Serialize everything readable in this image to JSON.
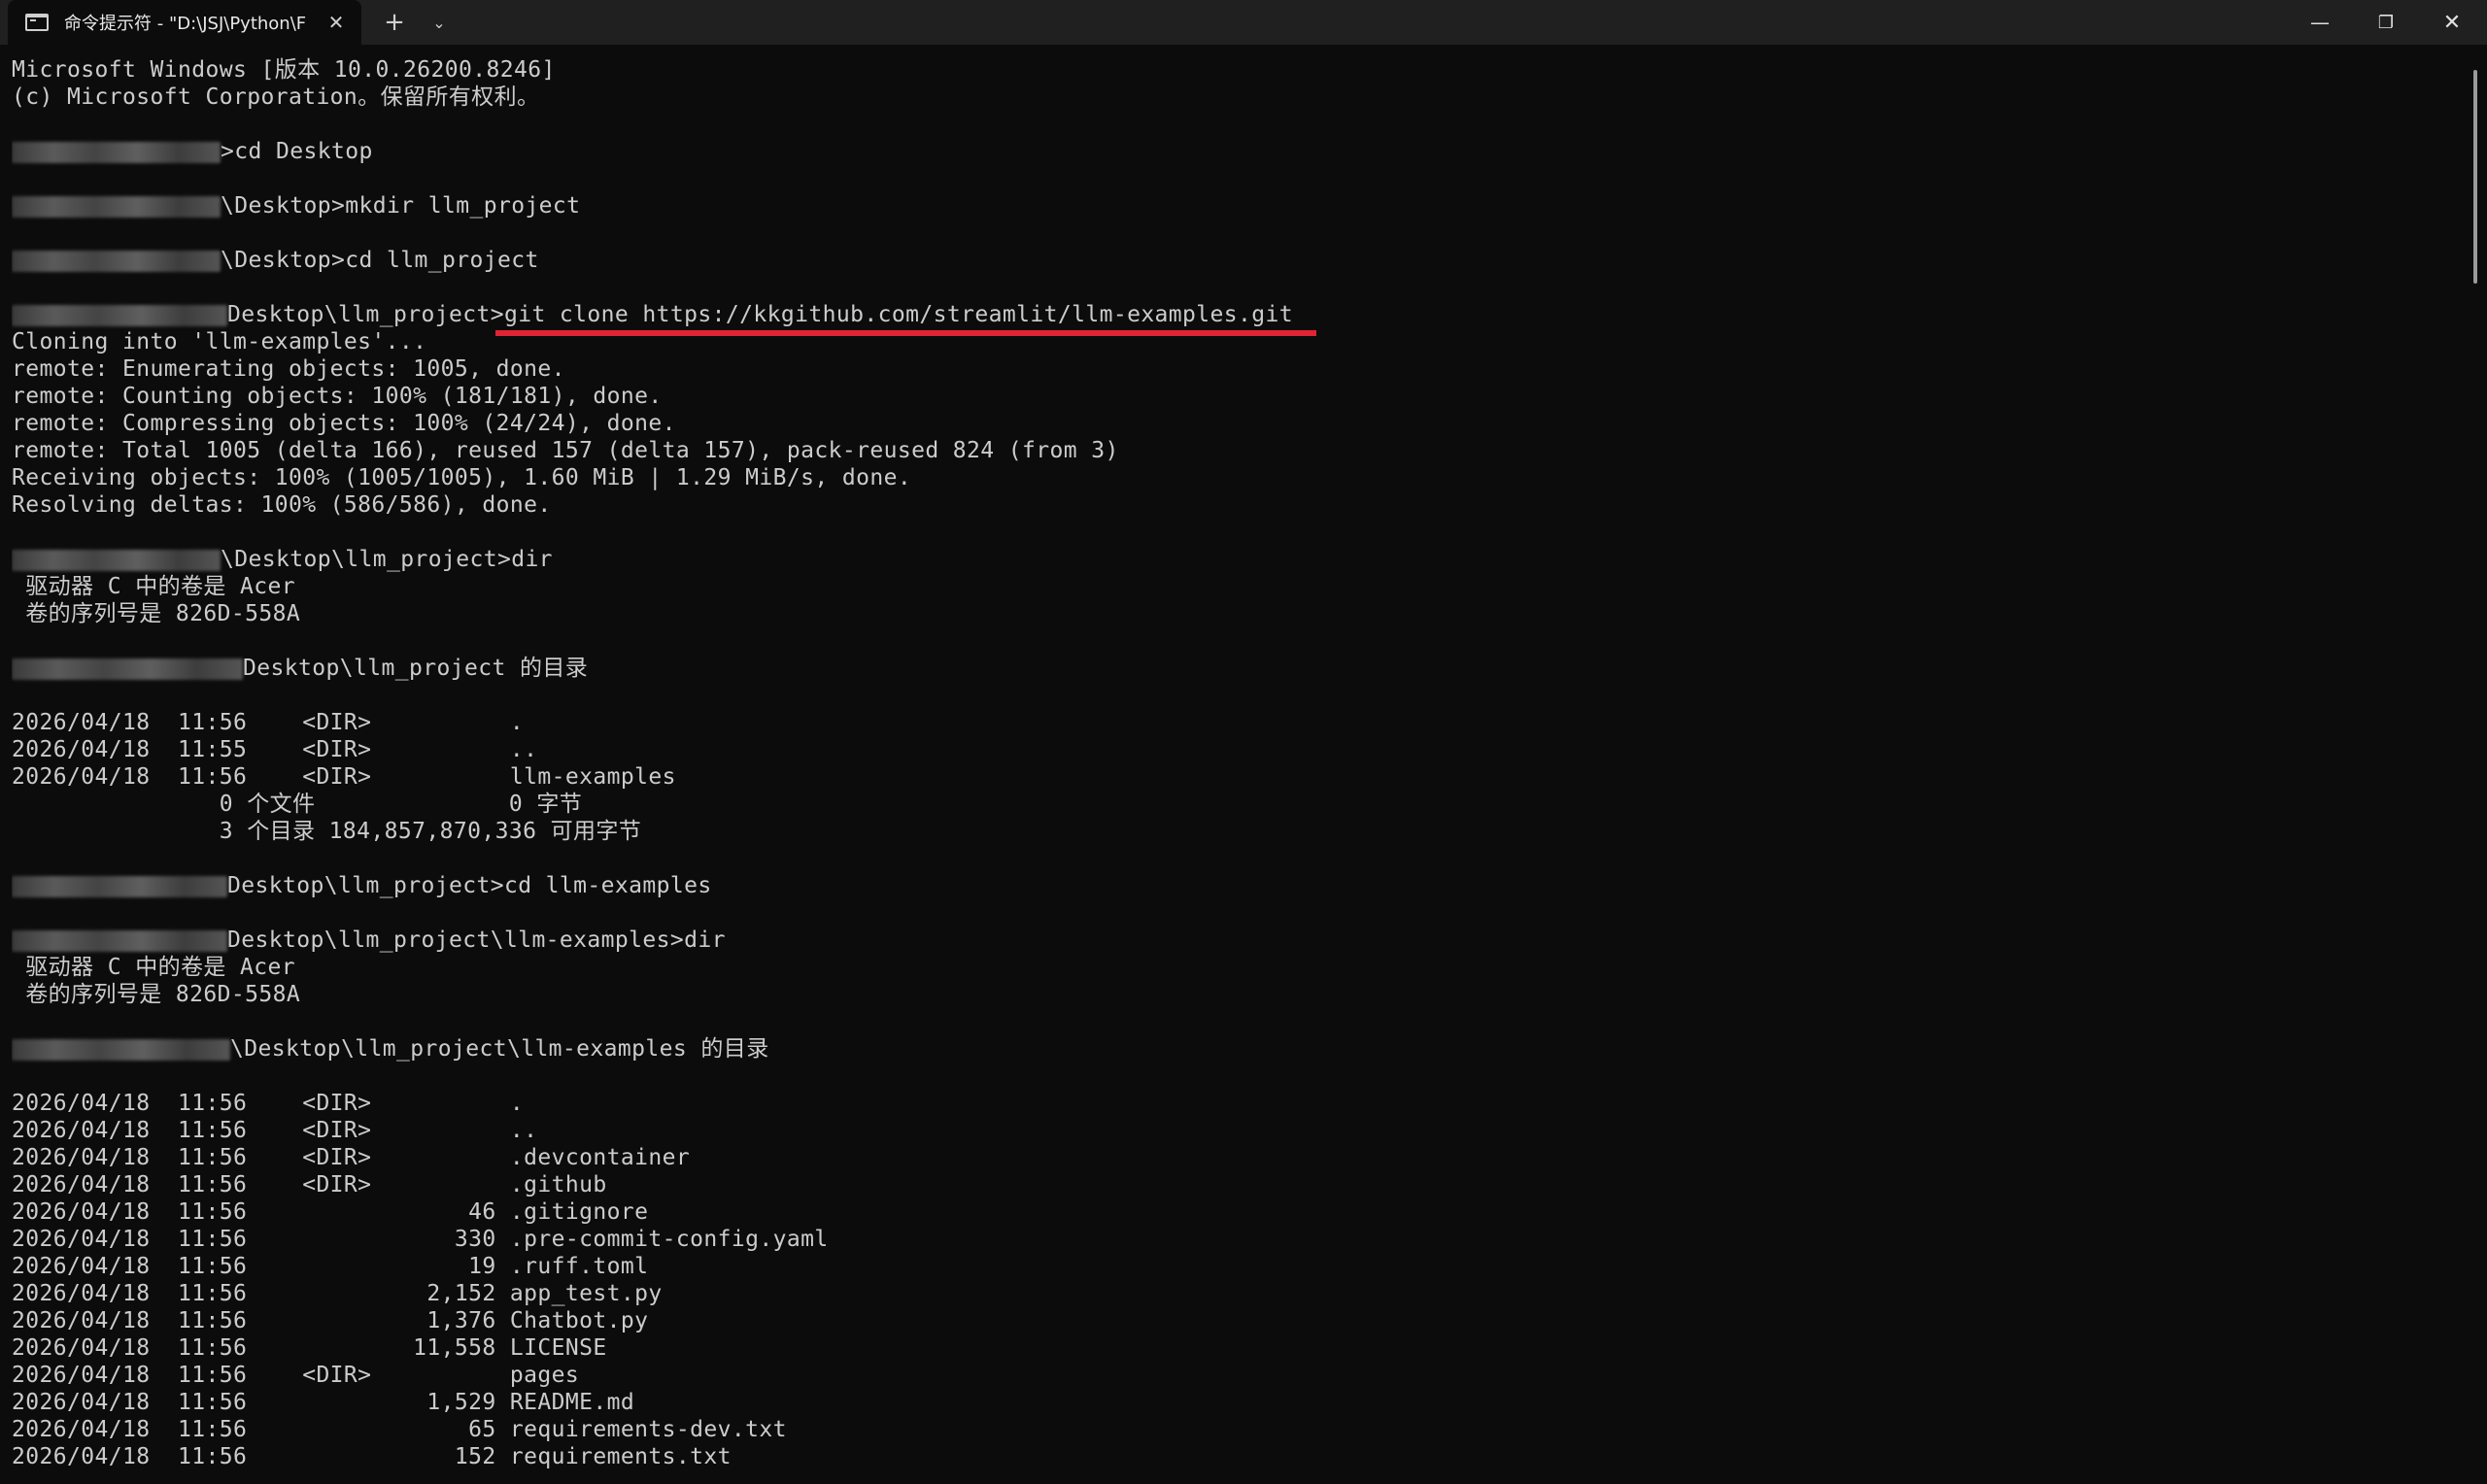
{
  "window": {
    "tab_title": "命令提示符 - \"D:\\JSJ\\Python\\F",
    "tab_close": "✕",
    "new_tab": "+",
    "dropdown": "⌄",
    "minimize": "—",
    "maximize": "❐",
    "close": "✕",
    "annotation_color": "#e02433"
  },
  "terminal": {
    "lines": [
      {
        "text": "Microsoft Windows [版本 10.0.26200.8246]"
      },
      {
        "text": "(c) Microsoft Corporation。保留所有权利。"
      },
      {
        "text": ""
      },
      {
        "redact": 215,
        "text": ">cd Desktop"
      },
      {
        "text": ""
      },
      {
        "redact": 215,
        "text": "\\Desktop>mkdir llm_project"
      },
      {
        "text": ""
      },
      {
        "redact": 215,
        "text": "\\Desktop>cd llm_project"
      },
      {
        "text": ""
      },
      {
        "redact": 222,
        "text": "Desktop\\llm_project>git clone https://kkgithub.com/streamlit/llm-examples.git"
      },
      {
        "text": "Cloning into 'llm-examples'..."
      },
      {
        "text": "remote: Enumerating objects: 1005, done."
      },
      {
        "text": "remote: Counting objects: 100% (181/181), done."
      },
      {
        "text": "remote: Compressing objects: 100% (24/24), done."
      },
      {
        "text": "remote: Total 1005 (delta 166), reused 157 (delta 157), pack-reused 824 (from 3)"
      },
      {
        "text": "Receiving objects: 100% (1005/1005), 1.60 MiB | 1.29 MiB/s, done."
      },
      {
        "text": "Resolving deltas: 100% (586/586), done."
      },
      {
        "text": ""
      },
      {
        "redact": 215,
        "text": "\\Desktop\\llm_project>dir"
      },
      {
        "text": " 驱动器 C 中的卷是 Acer"
      },
      {
        "text": " 卷的序列号是 826D-558A"
      },
      {
        "text": ""
      },
      {
        "redact": 238,
        "text": "Desktop\\llm_project 的目录"
      },
      {
        "text": ""
      },
      {
        "text": "2026/04/18  11:56    <DIR>          ."
      },
      {
        "text": "2026/04/18  11:55    <DIR>          .."
      },
      {
        "text": "2026/04/18  11:56    <DIR>          llm-examples"
      },
      {
        "text": "               0 个文件              0 字节"
      },
      {
        "text": "               3 个目录 184,857,870,336 可用字节"
      },
      {
        "text": ""
      },
      {
        "redact": 222,
        "text": "Desktop\\llm_project>cd llm-examples"
      },
      {
        "text": ""
      },
      {
        "redact": 222,
        "text": "Desktop\\llm_project\\llm-examples>dir"
      },
      {
        "text": " 驱动器 C 中的卷是 Acer"
      },
      {
        "text": " 卷的序列号是 826D-558A"
      },
      {
        "text": ""
      },
      {
        "redact": 225,
        "text": "\\Desktop\\llm_project\\llm-examples 的目录"
      },
      {
        "text": ""
      },
      {
        "text": "2026/04/18  11:56    <DIR>          ."
      },
      {
        "text": "2026/04/18  11:56    <DIR>          .."
      },
      {
        "text": "2026/04/18  11:56    <DIR>          .devcontainer"
      },
      {
        "text": "2026/04/18  11:56    <DIR>          .github"
      },
      {
        "text": "2026/04/18  11:56                46 .gitignore"
      },
      {
        "text": "2026/04/18  11:56               330 .pre-commit-config.yaml"
      },
      {
        "text": "2026/04/18  11:56                19 .ruff.toml"
      },
      {
        "text": "2026/04/18  11:56             2,152 app_test.py"
      },
      {
        "text": "2026/04/18  11:56             1,376 Chatbot.py"
      },
      {
        "text": "2026/04/18  11:56            11,558 LICENSE"
      },
      {
        "text": "2026/04/18  11:56    <DIR>          pages"
      },
      {
        "text": "2026/04/18  11:56             1,529 README.md"
      },
      {
        "text": "2026/04/18  11:56                65 requirements-dev.txt"
      },
      {
        "text": "2026/04/18  11:56               152 requirements.txt"
      }
    ]
  }
}
